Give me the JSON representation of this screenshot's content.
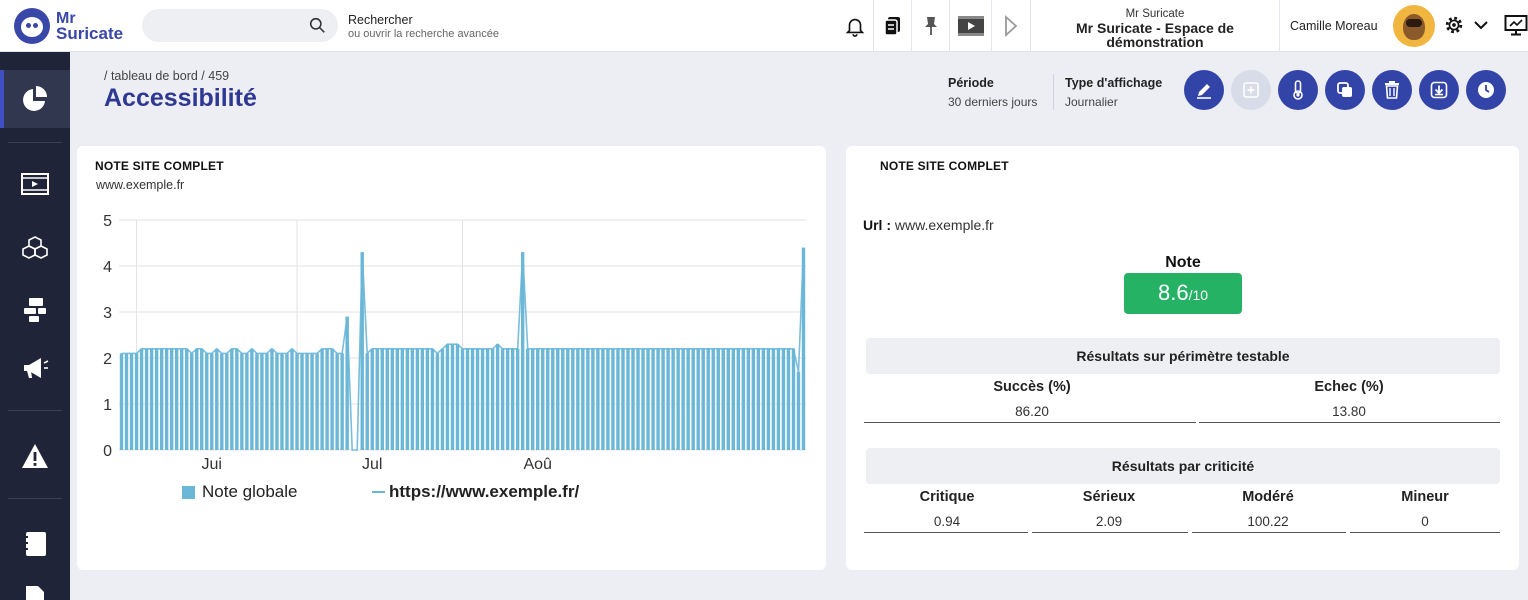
{
  "app": {
    "logo_line1": "Mr",
    "logo_line2": "Suricate"
  },
  "search": {
    "placeholder": "",
    "hint_title": "Rechercher",
    "hint_sub": "ou ouvrir la recherche avancée"
  },
  "header": {
    "icons": [
      "bell-icon",
      "clipboard-icon",
      "pin-icon",
      "video-icon",
      "play-icon"
    ],
    "space_label": "Mr Suricate",
    "space_name": "Mr Suricate - Espace de démonstration",
    "user_name": "Camille Moreau"
  },
  "sidebar": {
    "items": [
      "dashboard-icon",
      "video-icon",
      "cubes-icon",
      "puzzle-icon",
      "megaphone-icon",
      "warning-icon",
      "notebook-icon",
      "document-icon"
    ]
  },
  "page": {
    "breadcrumb": "/ tableau de bord / 459",
    "title": "Accessibilité",
    "period_label": "Période",
    "period_value": "30 derniers jours",
    "display_label": "Type d'affichage",
    "display_value": "Journalier",
    "accent_color": "#3344a8"
  },
  "left_card": {
    "title": "NOTE SITE COMPLET",
    "subtitle": "www.exemple.fr"
  },
  "chart_data": {
    "type": "bar",
    "ylim": [
      0,
      5
    ],
    "yticks": [
      0,
      1,
      2,
      3,
      4,
      5
    ],
    "xticks": [
      {
        "label": "Jui",
        "index": 18
      },
      {
        "label": "Jul",
        "index": 50
      },
      {
        "label": "Aoû",
        "index": 83
      }
    ],
    "grid": true,
    "legend": "bottom",
    "bar_color": "#6bb7d8",
    "series": [
      {
        "name": "Note globale",
        "kind": "bar",
        "values": [
          2.1,
          2.1,
          2.1,
          2.1,
          2.2,
          2.2,
          2.2,
          2.2,
          2.2,
          2.2,
          2.2,
          2.2,
          2.2,
          2.2,
          2.1,
          2.2,
          2.2,
          2.1,
          2.1,
          2.2,
          2.1,
          2.1,
          2.2,
          2.2,
          2.1,
          2.1,
          2.2,
          2.1,
          2.1,
          2.1,
          2.2,
          2.1,
          2.1,
          2.1,
          2.2,
          2.1,
          2.1,
          2.1,
          2.1,
          2.1,
          2.2,
          2.2,
          2.2,
          2.1,
          2.1,
          2.9,
          0.0,
          0.0,
          4.3,
          2.1,
          2.2,
          2.2,
          2.2,
          2.2,
          2.2,
          2.2,
          2.2,
          2.2,
          2.2,
          2.2,
          2.2,
          2.2,
          2.2,
          2.1,
          2.2,
          2.3,
          2.3,
          2.3,
          2.2,
          2.2,
          2.2,
          2.2,
          2.2,
          2.2,
          2.2,
          2.3,
          2.2,
          2.2,
          2.2,
          2.2,
          4.3,
          2.2,
          2.2,
          2.2,
          2.2,
          2.2,
          2.2,
          2.2,
          2.2,
          2.2,
          2.2,
          2.2,
          2.2,
          2.2,
          2.2,
          2.2,
          2.2,
          2.2,
          2.2,
          2.2,
          2.2,
          2.2,
          2.2,
          2.2,
          2.2,
          2.2,
          2.2,
          2.2,
          2.2,
          2.2,
          2.2,
          2.2,
          2.2,
          2.2,
          2.2,
          2.2,
          2.2,
          2.2,
          2.2,
          2.2,
          2.2,
          2.2,
          2.2,
          2.2,
          2.2,
          2.2,
          2.2,
          2.2,
          2.2,
          2.2,
          2.2,
          2.2,
          2.2,
          2.2,
          2.2,
          1.7,
          4.4
        ]
      },
      {
        "name": "https://www.exemple.fr/",
        "kind": "line"
      }
    ]
  },
  "right_card": {
    "title": "NOTE SITE COMPLET",
    "url_label": "Url :",
    "url_value": "www.exemple.fr",
    "note_label": "Note",
    "note_value": "8.6",
    "note_max": "/10",
    "note_color": "#25b264",
    "testable_title": "Résultats sur périmètre testable",
    "testable_cols": [
      {
        "label": "Succès (%)",
        "value": "86.20"
      },
      {
        "label": "Echec (%)",
        "value": "13.80"
      }
    ],
    "criticity_title": "Résultats par criticité",
    "criticity_cols": [
      {
        "label": "Critique",
        "value": "0.94"
      },
      {
        "label": "Sérieux",
        "value": "2.09"
      },
      {
        "label": "Modéré",
        "value": "100.22"
      },
      {
        "label": "Mineur",
        "value": "0"
      }
    ]
  }
}
